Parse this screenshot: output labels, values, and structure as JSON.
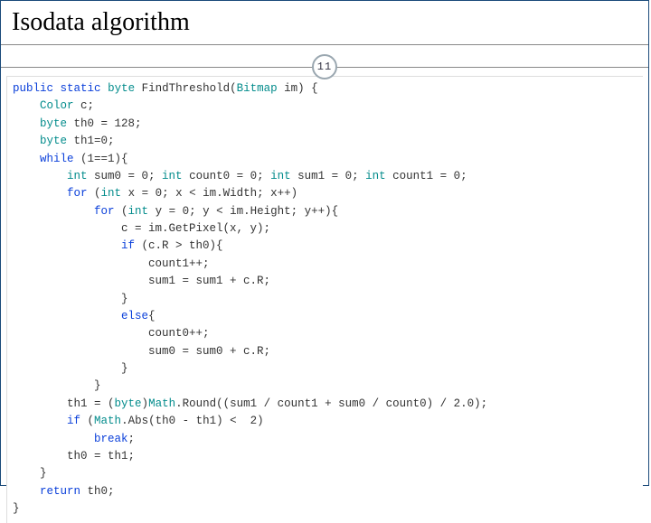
{
  "slide": {
    "title": "Isodata algorithm",
    "page_number": "11"
  },
  "code": {
    "l01a": "public",
    "l01b": " ",
    "l01c": "static",
    "l01d": " ",
    "l01e": "byte",
    "l01f": " FindThreshold(",
    "l01g": "Bitmap",
    "l01h": " im) {",
    "l02a": "    ",
    "l02b": "Color",
    "l02c": " c;",
    "l03a": "    ",
    "l03b": "byte",
    "l03c": " th0 = 128;",
    "l04a": "    ",
    "l04b": "byte",
    "l04c": " th1=0;",
    "l05a": "    ",
    "l05b": "while",
    "l05c": " (1==1){",
    "l06a": "        ",
    "l06b": "int",
    "l06c": " sum0 = 0; ",
    "l06d": "int",
    "l06e": " count0 = 0; ",
    "l06f": "int",
    "l06g": " sum1 = 0; ",
    "l06h": "int",
    "l06i": " count1 = 0;",
    "l07a": "        ",
    "l07b": "for",
    "l07c": " (",
    "l07d": "int",
    "l07e": " x = 0; x < im.Width; x++)",
    "l08a": "            ",
    "l08b": "for",
    "l08c": " (",
    "l08d": "int",
    "l08e": " y = 0; y < im.Height; y++){",
    "l09": "                c = im.GetPixel(x, y);",
    "l10a": "                ",
    "l10b": "if",
    "l10c": " (c.R > th0){",
    "l11": "                    count1++;",
    "l12": "                    sum1 = sum1 + c.R;",
    "l13": "                }",
    "l14a": "                ",
    "l14b": "else",
    "l14c": "{",
    "l15": "                    count0++;",
    "l16": "                    sum0 = sum0 + c.R;",
    "l17": "                }",
    "l18": "            }",
    "l19a": "        th1 = (",
    "l19b": "byte",
    "l19c": ")",
    "l19d": "Math",
    "l19e": ".Round((sum1 / count1 + sum0 / count0) / 2.0);",
    "l20a": "        ",
    "l20b": "if",
    "l20c": " (",
    "l20d": "Math",
    "l20e": ".Abs(th0 - th1) <  2)",
    "l21a": "            ",
    "l21b": "break",
    "l21c": ";",
    "l22": "        th0 = th1;",
    "l23": "    }",
    "l24a": "    ",
    "l24b": "return",
    "l24c": " th0;",
    "l25": "}"
  }
}
